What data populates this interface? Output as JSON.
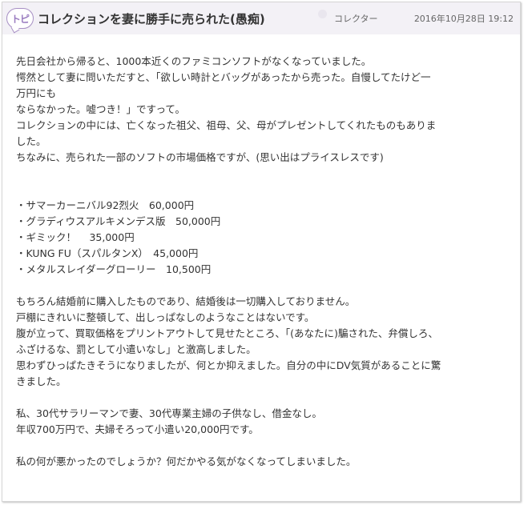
{
  "post": {
    "badge": "トピ",
    "title": "コレクションを妻に勝手に売られた(愚痴)",
    "author": "コレクター",
    "date": "2016年10月28日 19:12",
    "colors": {
      "accent": "#9a7cc0",
      "header_bg": "#f3f1f6"
    },
    "lines": [
      "先日会社から帰ると、1000本近くのファミコンソフトがなくなっていました。",
      "愕然として妻に問いただすと、「欲しい時計とバッグがあったから売った。自慢してたけど一",
      "万円にも",
      "ならなかった。嘘つき！」ですって。",
      "コレクションの中には、亡くなった祖父、祖母、父、母がプレゼントしてくれたものもありま",
      "した。",
      "ちなみに、売られた一部のソフトの市場価格ですが、(思い出はプライスレスです)",
      "",
      "",
      "・サマーカーニバル92烈火　60,000円",
      "・グラディウスアルキメンデス版　50,000円",
      "・ギミック！　 35,000円",
      "・KUNG FU（スパルタンX）　45,000円",
      "・メタルスレイダーグローリー　10,500円",
      "",
      "もちろん結婚前に購入したものであり、結婚後は一切購入しておりません。",
      "戸棚にきれいに整頓して、出しっぱなしのようなことはないです。",
      "腹が立って、買取価格をプリントアウトして見せたところ、「(あなたに)騙された、弁償しろ、",
      "ふざけるな、罰として小遣いなし」と激高しました。",
      "思わずひっぱたきそうになりましたが、何とか抑えました。自分の中にDV気質があることに驚",
      "きました。",
      "",
      "私、30代サラリーマンで妻、30代専業主婦の子供なし、借金なし。",
      "年収700万円で、夫婦そろって小遣い20,000円です。",
      "",
      "私の何が悪かったのでしょうか？何だかやる気がなくなってしまいました。"
    ]
  }
}
